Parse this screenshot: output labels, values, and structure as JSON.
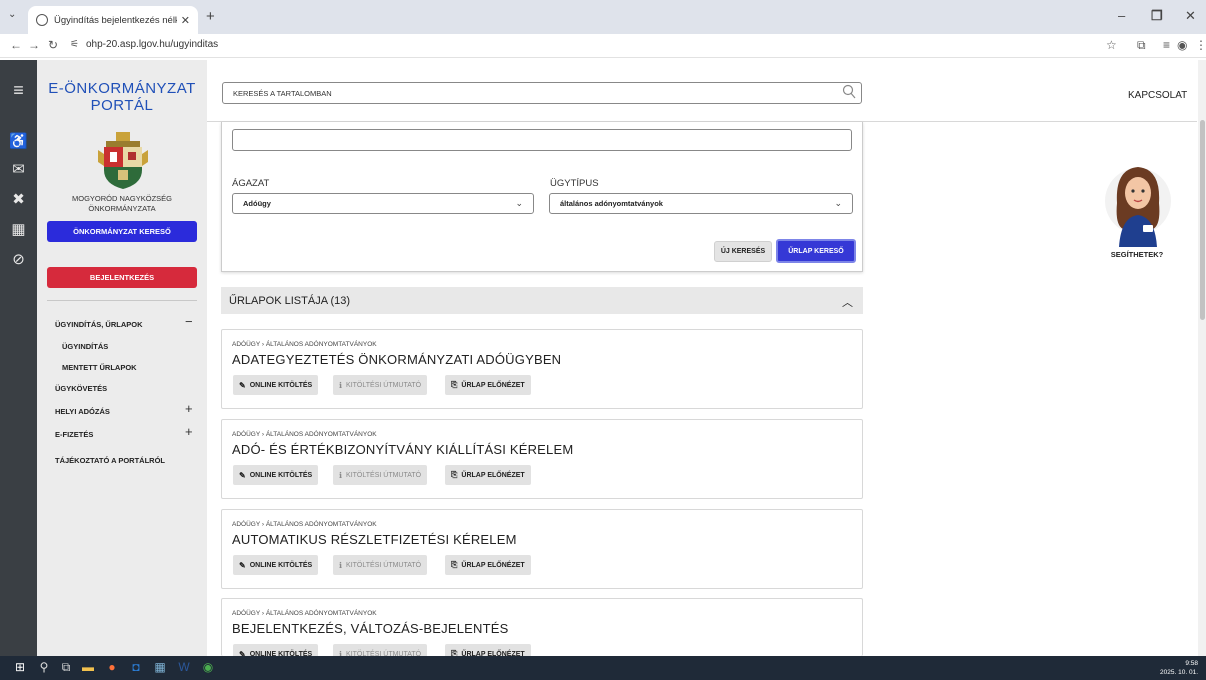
{
  "browser": {
    "tab_title": "Ügyindítás bejelentkezés nélkül",
    "url": "ohp-20.asp.lgov.hu/ugyinditas"
  },
  "header": {
    "portal_title": "E-ÖNKORMÁNYZAT PORTÁL",
    "search_placeholder": "KERESÉS A TARTALOMBAN",
    "contact": "KAPCSOLAT"
  },
  "sidebar": {
    "municipality": "MOGYORÓD NAGYKÖZSÉG ÖNKORMÁNYZATA",
    "finder_button": "ÖNKORMÁNYZAT KERESŐ",
    "login_button": "BEJELENTKEZÉS",
    "items": [
      {
        "label": "ÜGYINDÍTÁS, ŰRLAPOK",
        "toggle": "−"
      },
      {
        "label": "ÜGYINDÍTÁS"
      },
      {
        "label": "MENTETT ŰRLAPOK"
      },
      {
        "label": "ÜGYKÖVETÉS"
      },
      {
        "label": "HELYI ADÓZÁS",
        "toggle": "+"
      },
      {
        "label": "E-FIZETÉS",
        "toggle": "+"
      },
      {
        "label": "TÁJÉKOZTATÓ A PORTÁLRÓL"
      }
    ]
  },
  "filters": {
    "sector_label": "ÁGAZAT",
    "sector_value": "Adóügy",
    "type_label": "ÜGYTÍPUS",
    "type_value": "általános adónyomtatványok",
    "new_search": "ÚJ KERESÉS",
    "form_search": "ŰRLAP KERESŐ"
  },
  "assistant": {
    "label": "SEGÍTHETEK?"
  },
  "list": {
    "header": "ŰRLAPOK LISTÁJA (13)",
    "buttons": {
      "online": "ONLINE KITÖLTÉS",
      "guide": "KITÖLTÉSI ÚTMUTATÓ",
      "preview": "ŰRLAP ELŐNÉZET"
    },
    "items": [
      {
        "crumb": "ADÓÜGY › ÁLTALÁNOS ADÓNYOMTATVÁNYOK",
        "title": "ADATEGYEZTETÉS ÖNKORMÁNYZATI ADÓÜGYBEN"
      },
      {
        "crumb": "ADÓÜGY › ÁLTALÁNOS ADÓNYOMTATVÁNYOK",
        "title": "ADÓ- ÉS ÉRTÉKBIZONYÍTVÁNY KIÁLLÍTÁSI KÉRELEM"
      },
      {
        "crumb": "ADÓÜGY › ÁLTALÁNOS ADÓNYOMTATVÁNYOK",
        "title": "AUTOMATIKUS RÉSZLETFIZETÉSI KÉRELEM"
      },
      {
        "crumb": "ADÓÜGY › ÁLTALÁNOS ADÓNYOMTATVÁNYOK",
        "title": "BEJELENTKEZÉS, VÁLTOZÁS-BEJELENTÉS"
      }
    ]
  },
  "taskbar": {
    "time": "9:58",
    "date": "2025. 10. 01."
  }
}
